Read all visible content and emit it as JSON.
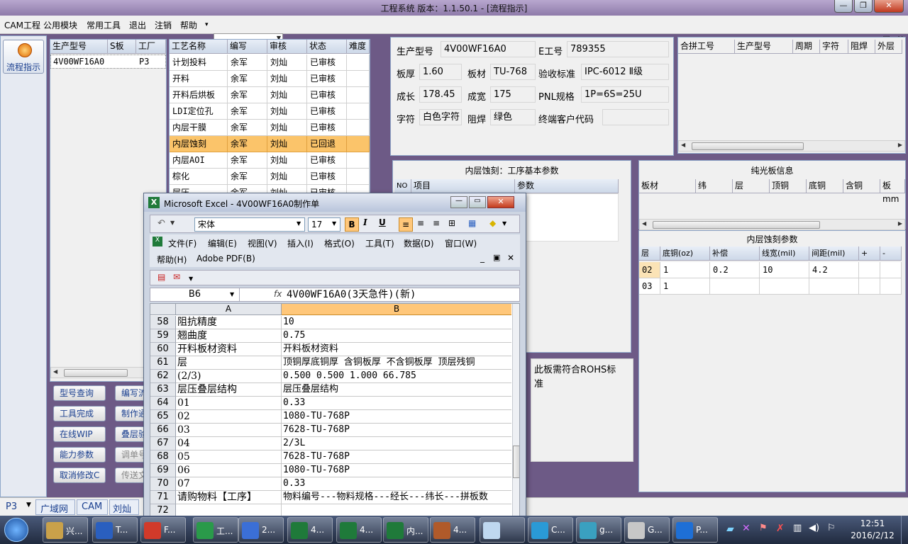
{
  "app": {
    "title": "工程系统   版本：1.1.50.1 - [流程指示]",
    "win_buttons": [
      "—",
      "❐",
      "✕"
    ],
    "menu": [
      "CAM工程",
      "公用模块",
      "常用工具",
      "退出",
      "注销",
      "帮助"
    ],
    "help_arrow": "▾",
    "mdi_buttons": [
      "_",
      "▣",
      "✕"
    ]
  },
  "left_bar": {
    "flow_button": "流程指示"
  },
  "orders": {
    "headers": [
      "生产型号",
      "S板",
      "工厂"
    ],
    "rows": [
      [
        "4V00WF16A0",
        "",
        "P3"
      ]
    ]
  },
  "process": {
    "headers": [
      "工艺名称",
      "编写",
      "审核",
      "状态",
      "难度"
    ],
    "rows": [
      [
        "计划投料",
        "余军",
        "刘灿",
        "已审核",
        ""
      ],
      [
        "开料",
        "余军",
        "刘灿",
        "已审核",
        ""
      ],
      [
        "开料后烘板",
        "余军",
        "刘灿",
        "已审核",
        ""
      ],
      [
        "LDI定位孔",
        "余军",
        "刘灿",
        "已审核",
        ""
      ],
      [
        "内层干膜",
        "余军",
        "刘灿",
        "已审核",
        ""
      ],
      [
        "内层蚀刻",
        "余军",
        "刘灿",
        "已回退",
        ""
      ],
      [
        "内层AOI",
        "余军",
        "刘灿",
        "已审核",
        ""
      ],
      [
        "棕化",
        "余军",
        "刘灿",
        "已审核",
        ""
      ],
      [
        "层压",
        "余军",
        "刘灿",
        "已审核",
        ""
      ]
    ],
    "selected_index": 5
  },
  "buttons": [
    [
      "型号查询",
      "编写流"
    ],
    [
      "工具完成",
      "制作通"
    ],
    [
      "在线WIP",
      "叠层验"
    ],
    [
      "能力参数",
      "调单号"
    ],
    [
      "取消修改C",
      "传送文"
    ]
  ],
  "info": {
    "model_label": "生产型号",
    "model_value": "4V00WF16A0",
    "eno_label": "E工号",
    "eno_value": "789355",
    "thick_label": "板厚",
    "thick_value": "1.60",
    "material_label": "板材",
    "material_value": "TU-768",
    "standard_label": "验收标准",
    "standard_value": "IPC-6012 Ⅱ级",
    "length_label": "成长",
    "length_value": "178.45",
    "width_label": "成宽",
    "width_value": "175",
    "pnl_label": "PNL规格",
    "pnl_value": "1P=6S=25U",
    "legend_label": "字符",
    "legend_value": "白色字符",
    "mask_label": "阻焊",
    "mask_value": "绿色",
    "customer_label": "终端客户代码",
    "customer_value": ""
  },
  "combine": {
    "headers": [
      "合拼工号",
      "生产型号",
      "周期",
      "字符",
      "阻焊",
      "外层"
    ]
  },
  "etch_basic": {
    "title": "内层蚀刻：工序基本参数",
    "headers": [
      "NO",
      "项目",
      "参数"
    ]
  },
  "plain_board": {
    "title": "纯光板信息",
    "headers": [
      "板材",
      "纬",
      "层",
      "顶铜",
      "底铜",
      "含铜",
      "板mm"
    ]
  },
  "etch_params": {
    "title": "内层蚀刻参数",
    "headers": [
      "层",
      "底铜(oz)",
      "补偿",
      "线宽(mil)",
      "间距(mil)",
      "+",
      "-"
    ],
    "rows": [
      [
        "02",
        "1",
        "0.2",
        "10",
        "4.2",
        "",
        ""
      ],
      [
        "03",
        "1",
        "",
        "",
        "",
        "",
        ""
      ]
    ]
  },
  "rohs_note": "此板需符合ROHS标准",
  "status_bar": {
    "items": [
      "P3",
      "广域网",
      "CAM",
      "刘灿"
    ]
  },
  "excel": {
    "title": "Microsoft Excel - 4V00WF16A0制作单",
    "font": "宋体",
    "size": "17",
    "menus": [
      "文件(F)",
      "编辑(E)",
      "视图(V)",
      "插入(I)",
      "格式(O)",
      "工具(T)",
      "数据(D)",
      "窗口(W)",
      "帮助(H)",
      "Adobe PDF(B)"
    ],
    "name_box": "B6",
    "fx": "fx",
    "formula": "4V00WF16A0(3天急件)(新)",
    "col_a": "A",
    "col_b": "B",
    "rows": [
      [
        "58",
        "阻抗精度",
        "10"
      ],
      [
        "59",
        "翘曲度",
        "0.75"
      ],
      [
        "60",
        "开料板材资料",
        "开料板材资料"
      ],
      [
        "61",
        "层",
        "顶铜厚底铜厚 含铜板厚 不含铜板厚 顶层残铜"
      ],
      [
        "62",
        "(2/3)",
        "0.500  0.500   1.000              66.785"
      ],
      [
        "63",
        "层压叠层结构",
        "层压叠层结构"
      ],
      [
        "64",
        "01",
        "0.33"
      ],
      [
        "65",
        "02",
        "1080-TU-768P"
      ],
      [
        "66",
        "03",
        "7628-TU-768P"
      ],
      [
        "67",
        "04",
        "2/3L"
      ],
      [
        "68",
        "05",
        "7628-TU-768P"
      ],
      [
        "69",
        "06",
        "1080-TU-768P"
      ],
      [
        "70",
        "07",
        "0.33"
      ],
      [
        "71",
        "请购物料【工序】",
        "物料编号---物料规格---经长---纬长---拼板数"
      ],
      [
        "72",
        "",
        ""
      ]
    ]
  },
  "taskbar": {
    "items": [
      "兴...",
      "T...",
      "F...",
      "工...",
      "2...",
      "4...",
      "4...",
      "内...",
      "4...",
      "",
      "C...",
      "g...",
      "G...",
      "P..."
    ],
    "time": "12:51",
    "date": "2016/2/12"
  }
}
